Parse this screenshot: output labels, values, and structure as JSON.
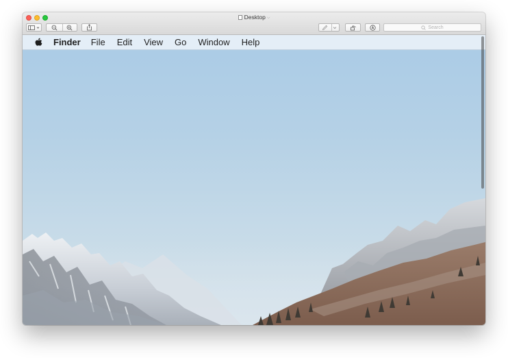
{
  "window": {
    "title": "Desktop",
    "search_placeholder": "Search"
  },
  "toolbar": {
    "buttons": [
      {
        "name": "sidebar-toggle-button",
        "icon": "sidebar-icon"
      },
      {
        "name": "zoom-out-button",
        "icon": "zoom-out-icon"
      },
      {
        "name": "zoom-in-button",
        "icon": "zoom-in-icon"
      },
      {
        "name": "share-button",
        "icon": "share-icon"
      },
      {
        "name": "markup-pen-button",
        "icon": "pen-icon"
      },
      {
        "name": "rotate-button",
        "icon": "rotate-icon"
      },
      {
        "name": "markup-toolbar-button",
        "icon": "markup-icon"
      }
    ]
  },
  "menubar": {
    "apple_icon": "apple-icon",
    "app_name": "Finder",
    "items": [
      "File",
      "Edit",
      "View",
      "Go",
      "Window",
      "Help"
    ]
  },
  "colors": {
    "sky_top": "#aacbe6",
    "sky_bottom": "#d4e1e9",
    "close": "#fc5f57",
    "minimize": "#fdbc2e",
    "maximize": "#28c840"
  }
}
